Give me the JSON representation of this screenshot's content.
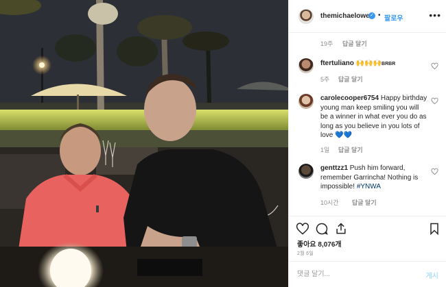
{
  "post": {
    "author": "themichaelowen",
    "follow_label": "팔로우",
    "separator": "•",
    "more_label": "•••",
    "verified_mark": "✓"
  },
  "comments": [
    {
      "time": "19주",
      "reply_label": "답글 달기"
    },
    {
      "username": "ftertuliano",
      "text": "🙌🙌🙌",
      "suffix": "BRBR",
      "time": "5주",
      "reply_label": "답글 달기"
    },
    {
      "username": "carolecooper6754",
      "text": "Happy birthday young man keep smiling you will be a winner in what ever you do as long as you believe in you lots of love 💙💙",
      "time": "1일",
      "reply_label": "답글 달기"
    },
    {
      "username": "genttzz1",
      "text": "Push him forward, remember Garrincha! Nothing is impossible!",
      "hashtag": "#YNWA",
      "time": "10시간",
      "reply_label": "답글 달기"
    }
  ],
  "icons": [
    "heart-icon",
    "comment-icon",
    "share-icon",
    "bookmark-icon",
    "verified-badge-icon"
  ],
  "likes_text": "좋아요 8,076개",
  "post_date": "2월 6일",
  "comment_box": {
    "placeholder": "댓글 달기...",
    "post_label": "게시"
  },
  "colors": {
    "accent": "#3897f0",
    "muted": "#8e8e8e",
    "text": "#262626",
    "border": "#efefef"
  }
}
